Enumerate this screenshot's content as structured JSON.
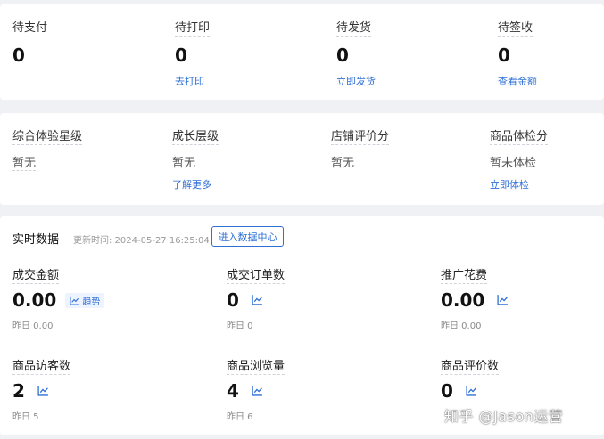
{
  "orders": [
    {
      "label": "待支付",
      "value": "0",
      "link": ""
    },
    {
      "label": "待打印",
      "value": "0",
      "link": "去打印"
    },
    {
      "label": "待发货",
      "value": "0",
      "link": "立即发货"
    },
    {
      "label": "待签收",
      "value": "0",
      "link": "查看金额"
    }
  ],
  "scores": [
    {
      "label": "综合体验星级",
      "value": "暂无",
      "link": ""
    },
    {
      "label": "成长层级",
      "value": "暂无",
      "link": "了解更多"
    },
    {
      "label": "店铺评价分",
      "value": "暂无",
      "link": ""
    },
    {
      "label": "商品体检分",
      "value": "暂未体检",
      "link": "立即体检"
    }
  ],
  "realtime": {
    "title": "实时数据",
    "updated": "更新时间: 2024-05-27 16:25:04",
    "enter_button": "进入数据中心",
    "trend_label": "趋势",
    "metrics": [
      {
        "label": "成交金额",
        "value": "0.00",
        "yesterday": "昨日 0.00"
      },
      {
        "label": "成交订单数",
        "value": "0",
        "yesterday": "昨日 0"
      },
      {
        "label": "推广花费",
        "value": "0.00",
        "yesterday": "昨日 0.00"
      },
      {
        "label": "商品访客数",
        "value": "2",
        "yesterday": "昨日 5"
      },
      {
        "label": "商品浏览量",
        "value": "4",
        "yesterday": "昨日 6"
      },
      {
        "label": "商品评价数",
        "value": "0",
        "yesterday": ""
      }
    ]
  },
  "watermark": "知乎 @Jason运营",
  "colors": {
    "accent": "#2f6fd6",
    "background": "#f0f1f4",
    "card": "#ffffff"
  }
}
